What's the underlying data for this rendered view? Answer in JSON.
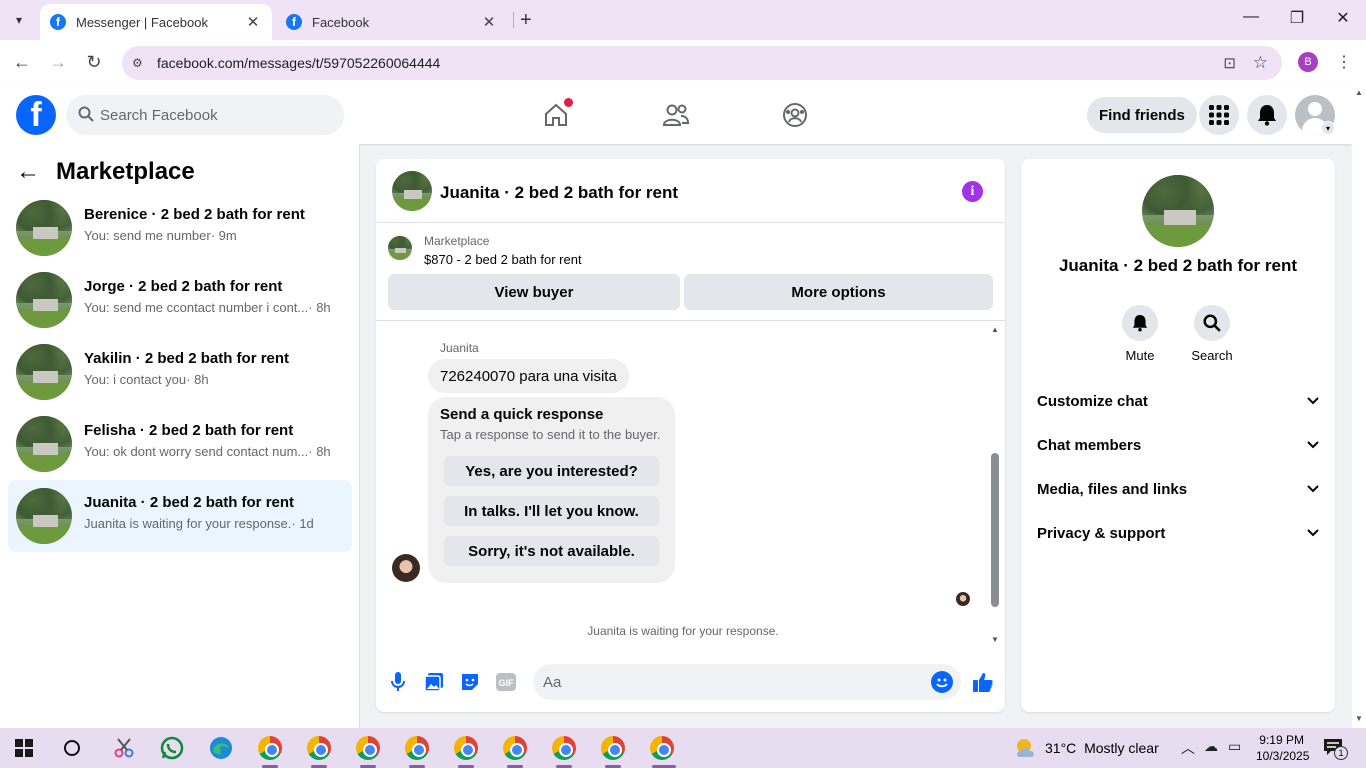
{
  "browser": {
    "tabs": [
      {
        "title": "Messenger | Facebook",
        "active": true
      },
      {
        "title": "Facebook",
        "active": false
      }
    ],
    "url": "facebook.com/messages/t/597052260064444",
    "profile_initial": "B"
  },
  "header": {
    "search_placeholder": "Search Facebook",
    "find_friends_label": "Find friends",
    "nav": [
      "home-icon",
      "friends-icon",
      "groups-icon"
    ],
    "notification_dot_color": "#e41e3f",
    "brand_color": "#0866ff"
  },
  "sidebar": {
    "title": "Marketplace",
    "conversations": [
      {
        "name": "Berenice · 2 bed 2 bath for rent",
        "snippet": "You: send me number",
        "time": " · 9m",
        "selected": false
      },
      {
        "name": "Jorge · 2 bed 2 bath for rent",
        "snippet": "You: send me ccontact number i cont...",
        "time": " · 8h",
        "selected": false
      },
      {
        "name": "Yakilin · 2 bed 2 bath for rent",
        "snippet": "You: i contact you",
        "time": " · 8h",
        "selected": false
      },
      {
        "name": "Felisha · 2 bed 2 bath for rent",
        "snippet": "You: ok dont worry send contact num...",
        "time": " · 8h",
        "selected": false
      },
      {
        "name": "Juanita · 2 bed 2 bath for rent",
        "snippet": "Juanita is waiting for your response.",
        "time": " · 1d",
        "selected": true
      }
    ]
  },
  "chat": {
    "title": "Juanita · 2 bed 2 bath for rent",
    "marketplace_label": "Marketplace",
    "listing": "$870 - 2 bed 2 bath for rent",
    "view_buyer_label": "View buyer",
    "more_options_label": "More options",
    "sender": "Juanita",
    "message": "726240070 para una visita",
    "quick_response": {
      "title": "Send a quick response",
      "subtitle": "Tap a response to send it to the buyer.",
      "options": [
        "Yes, are you interested?",
        "In talks. I'll let you know.",
        "Sorry, it's not available."
      ]
    },
    "waiting_text": "Juanita is waiting for your response.",
    "composer_placeholder": "Aa",
    "accent_color": "#0866ff"
  },
  "details": {
    "name": "Juanita · 2 bed 2 bath for rent",
    "actions": [
      {
        "label": "Mute",
        "icon": "bell-icon"
      },
      {
        "label": "Search",
        "icon": "search-icon"
      }
    ],
    "sections": [
      "Customize chat",
      "Chat members",
      "Media, files and links",
      "Privacy & support"
    ]
  },
  "taskbar": {
    "temperature": "31°C",
    "weather": "Mostly clear",
    "time": "9:19 PM",
    "date": "10/3/2025",
    "notification_count": "1"
  }
}
